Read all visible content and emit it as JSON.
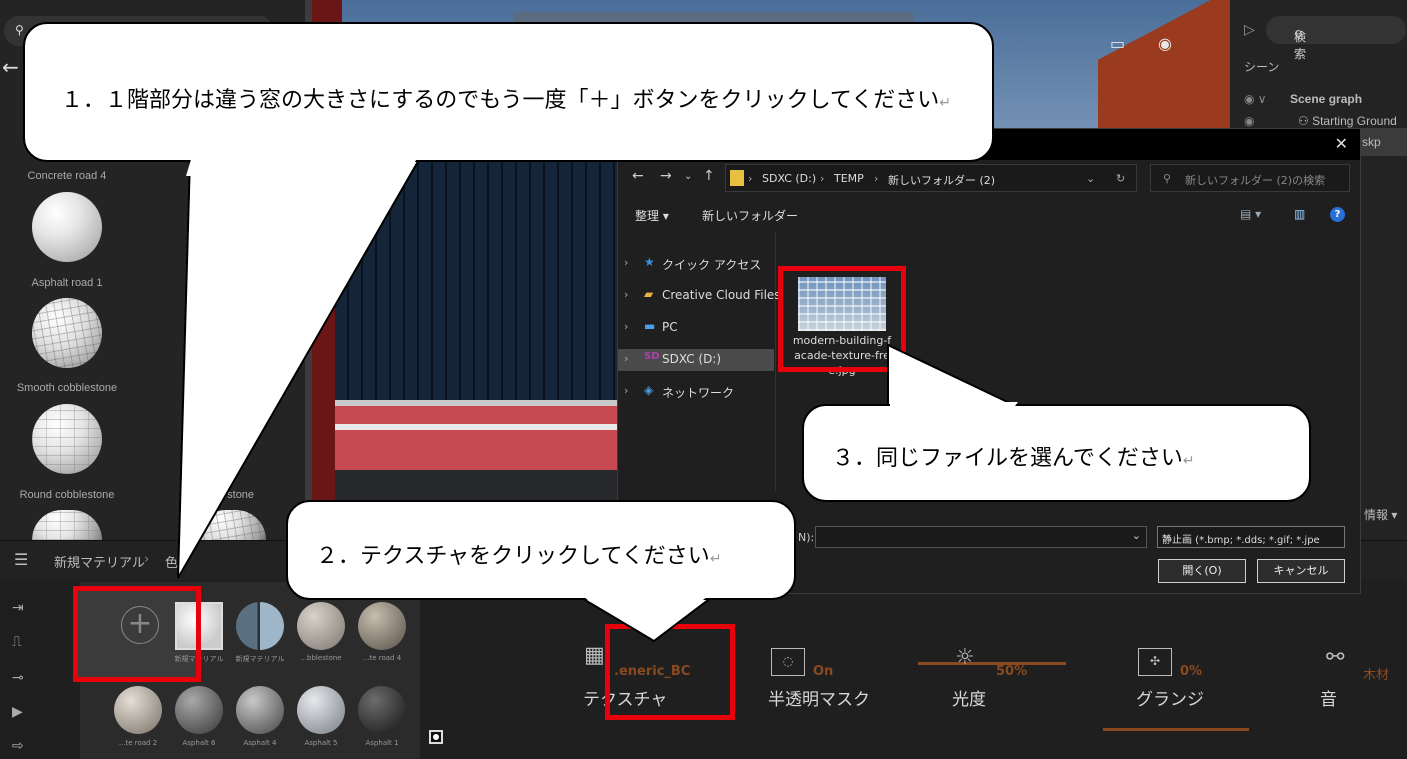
{
  "library": {
    "materials": [
      {
        "label": "Concrete road 4"
      },
      {
        "label": "Asphalt road 1"
      },
      {
        "label": "Smooth cobblestone"
      },
      {
        "label": "Round cobblestone"
      },
      {
        "label": "S...blestone"
      }
    ],
    "breadcrumb": {
      "root": "新規マテリアル",
      "separator": "›",
      "child": "色"
    }
  },
  "scene_panel": {
    "search_placeholder": "検索",
    "section": "シーン",
    "graph_title": "Scene graph",
    "items": [
      "Starting Ground",
      "skp"
    ],
    "info_label": "情報 ▾"
  },
  "dialog": {
    "close_icon": "✕",
    "path": [
      "SDXC (D:)",
      "TEMP",
      "新しいフォルダー (2)"
    ],
    "search_placeholder": "新しいフォルダー (2)の検索",
    "toolbar": {
      "organize": "整理 ▾",
      "new_folder": "新しいフォルダー"
    },
    "nav": [
      {
        "label": "クイック アクセス",
        "icon": "star-icon"
      },
      {
        "label": "Creative Cloud Files",
        "icon": "cloud-icon"
      },
      {
        "label": "PC",
        "icon": "monitor-icon"
      },
      {
        "label": "SDXC (D:)",
        "icon": "drive-icon",
        "selected": true
      },
      {
        "label": "ネットワーク",
        "icon": "network-icon"
      }
    ],
    "file": {
      "name": "modern-building-facade-texture-free.jpg"
    },
    "filename_label": "N):",
    "filetype": "静止画 (*.bmp; *.dds; *.gif; *.jpe",
    "open_button": "開く(O)",
    "cancel_button": "キャンセル"
  },
  "material_editor": {
    "thumbs_row1": [
      "新規マテリアル",
      "新規マテリアル",
      "...bblestone",
      "...te road 4"
    ],
    "thumbs_row2": [
      "...te road 2",
      "Asphalt 6",
      "Asphalt 4",
      "Asphalt 5",
      "Asphalt 1"
    ],
    "properties": [
      {
        "label": "テクスチャ",
        "value": ".eneric_BC"
      },
      {
        "label": "半透明マスク",
        "value": "On"
      },
      {
        "label": "光度",
        "value": "50%"
      },
      {
        "label": "グランジ",
        "value": "0%"
      },
      {
        "label": "音",
        "value": "木材"
      }
    ]
  },
  "callouts": {
    "step1": "１．１階部分は違う窓の大きさにするのでもう一度「＋」ボタンをクリックしてください",
    "step2": "２．テクスチャをクリックしてください",
    "step3": "３．同じファイルを選んでください",
    "return_mark": "↵"
  },
  "colors": {
    "highlight": "#e8000b",
    "accent": "#8a4a20"
  }
}
